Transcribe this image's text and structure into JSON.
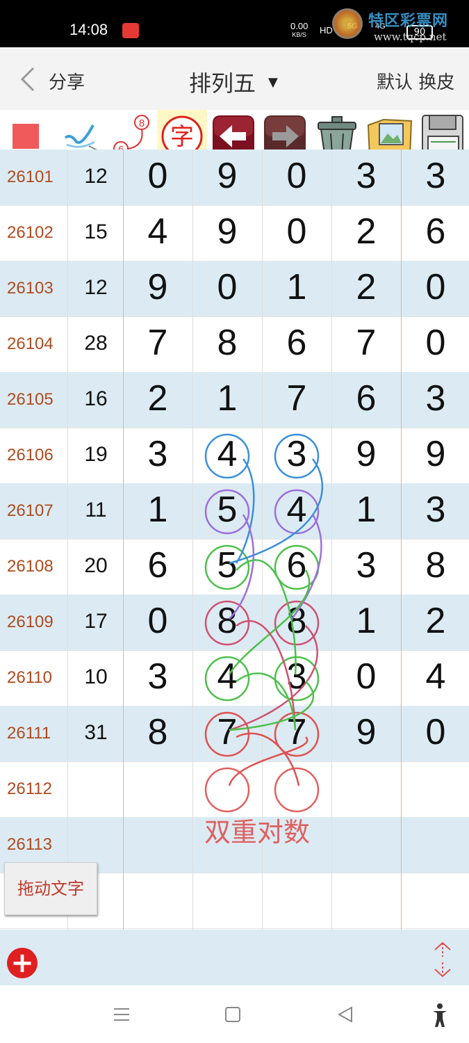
{
  "status_bar": {
    "time": "14:08",
    "net_speed": "0.00",
    "net_unit": "KB/S",
    "hd_label": "HD",
    "signal_5g": "5G",
    "signal_4g": "4G",
    "battery": "90"
  },
  "watermark": {
    "title": "特区彩票网",
    "url": "www.tqcp.net"
  },
  "nav": {
    "share": "分享",
    "title": "排列五",
    "default": "默认",
    "skin": "换皮"
  },
  "toolbar": {
    "tools": [
      "square-color",
      "check-mark",
      "badge-6-8",
      "char-tool",
      "undo",
      "redo",
      "trash",
      "picture",
      "save"
    ],
    "badge_top": "8",
    "badge_bottom": "6",
    "char_label": "字"
  },
  "rows": [
    {
      "id": "26101",
      "sum": "12",
      "digits": [
        "0",
        "9",
        "0",
        "3",
        "3"
      ]
    },
    {
      "id": "26102",
      "sum": "15",
      "digits": [
        "4",
        "9",
        "0",
        "2",
        "6"
      ]
    },
    {
      "id": "26103",
      "sum": "12",
      "digits": [
        "9",
        "0",
        "1",
        "2",
        "0"
      ]
    },
    {
      "id": "26104",
      "sum": "28",
      "digits": [
        "7",
        "8",
        "6",
        "7",
        "0"
      ]
    },
    {
      "id": "26105",
      "sum": "16",
      "digits": [
        "2",
        "1",
        "7",
        "6",
        "3"
      ]
    },
    {
      "id": "26106",
      "sum": "19",
      "digits": [
        "3",
        "4",
        "3",
        "9",
        "9"
      ]
    },
    {
      "id": "26107",
      "sum": "11",
      "digits": [
        "1",
        "5",
        "4",
        "1",
        "3"
      ]
    },
    {
      "id": "26108",
      "sum": "20",
      "digits": [
        "6",
        "5",
        "6",
        "3",
        "8"
      ]
    },
    {
      "id": "26109",
      "sum": "17",
      "digits": [
        "0",
        "8",
        "8",
        "1",
        "2"
      ]
    },
    {
      "id": "26110",
      "sum": "10",
      "digits": [
        "3",
        "4",
        "3",
        "0",
        "4"
      ]
    },
    {
      "id": "26111",
      "sum": "31",
      "digits": [
        "8",
        "7",
        "7",
        "9",
        "0"
      ]
    },
    {
      "id": "26112",
      "sum": "",
      "digits": [
        "",
        "",
        "",
        "",
        ""
      ]
    },
    {
      "id": "26113",
      "sum": "",
      "digits": [
        "",
        "",
        "",
        "",
        ""
      ]
    },
    {
      "id": "",
      "sum": "",
      "digits": [
        "",
        "",
        "",
        "",
        ""
      ]
    }
  ],
  "annotation": {
    "caption": "双重对数",
    "colors": {
      "blue": "#3a8fd8",
      "purple": "#9b6fdc",
      "green": "#4cc04c",
      "red": "#e05050"
    }
  },
  "drag_button": "拖动文字",
  "bottom": {
    "add_icon": "plus-circle-icon",
    "updown_icon": "up-down-arrows-icon"
  },
  "colors": {
    "row_shade": "#dcebf3",
    "id_text": "#b04a1e",
    "separator": "#e0b29a"
  }
}
